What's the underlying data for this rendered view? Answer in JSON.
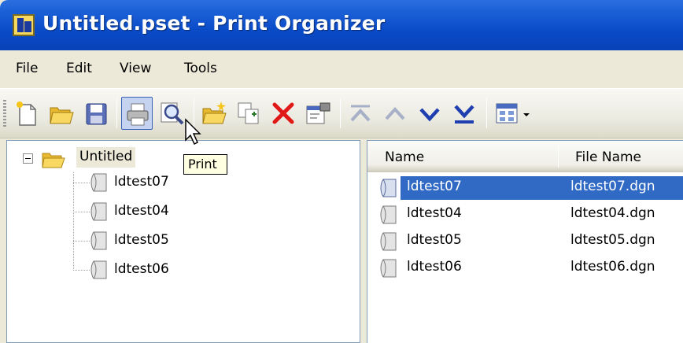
{
  "window": {
    "title": "Untitled.pset - Print Organizer"
  },
  "menu": {
    "items": [
      "File",
      "Edit",
      "View",
      "Tools"
    ]
  },
  "toolbar": {
    "buttons": [
      "new-icon",
      "open-folder-icon",
      "save-icon",
      "print-icon",
      "preview-icon",
      "add-folder-icon",
      "copy-icon",
      "delete-icon",
      "properties-icon",
      "move-top-icon",
      "move-up-icon",
      "move-down-icon",
      "move-bottom-icon",
      "display-options-icon"
    ],
    "tooltip": "Print"
  },
  "tree": {
    "root": "Untitled",
    "items": [
      "ldtest07",
      "ldtest04",
      "ldtest05",
      "ldtest06"
    ]
  },
  "list": {
    "columns": [
      "Name",
      "File Name"
    ],
    "rows": [
      {
        "name": "ldtest07",
        "file": "ldtest07.dgn",
        "selected": true
      },
      {
        "name": "ldtest04",
        "file": "ldtest04.dgn",
        "selected": false
      },
      {
        "name": "ldtest05",
        "file": "ldtest05.dgn",
        "selected": false
      },
      {
        "name": "ldtest06",
        "file": "ldtest06.dgn",
        "selected": false
      }
    ]
  },
  "colors": {
    "titlebar": "#0a4bc8",
    "selection": "#316ac5",
    "tooltip_bg": "#ffffe1",
    "delete_red": "#e01818",
    "arrow_blue": "#1f3fb0"
  }
}
